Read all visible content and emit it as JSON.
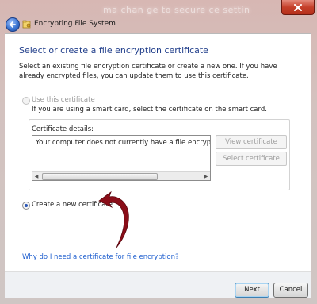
{
  "window": {
    "title": "Encrypting File System",
    "background_text": "ma chan ge to secure ce settin"
  },
  "page": {
    "heading": "Select or create a file encryption certificate",
    "intro": "Select an existing file encryption certificate or create a new one. If you have already encrypted files, you can update them to use this certificate."
  },
  "option_use": {
    "label": "Use this certificate",
    "description": "If you are using a smart card, select the certificate on the smart card.",
    "selected": false,
    "enabled": false
  },
  "certificate_details": {
    "label": "Certificate details:",
    "text": "Your computer does not currently have a file encryption ce",
    "view_label": "View certificate",
    "select_label": "Select certificate"
  },
  "option_create": {
    "label": "Create a new certificate",
    "selected": true
  },
  "help_link": "Why do I need a certificate for file encryption?",
  "buttons": {
    "next": "Next",
    "cancel": "Cancel"
  },
  "colors": {
    "heading": "#1f3d8a",
    "link": "#1f5fcf",
    "annotation_arrow": "#8a0d18",
    "close_button": "#c5402a"
  },
  "icons": {
    "back": "back-arrow-icon",
    "app": "efs-key-icon",
    "close": "close-icon"
  }
}
